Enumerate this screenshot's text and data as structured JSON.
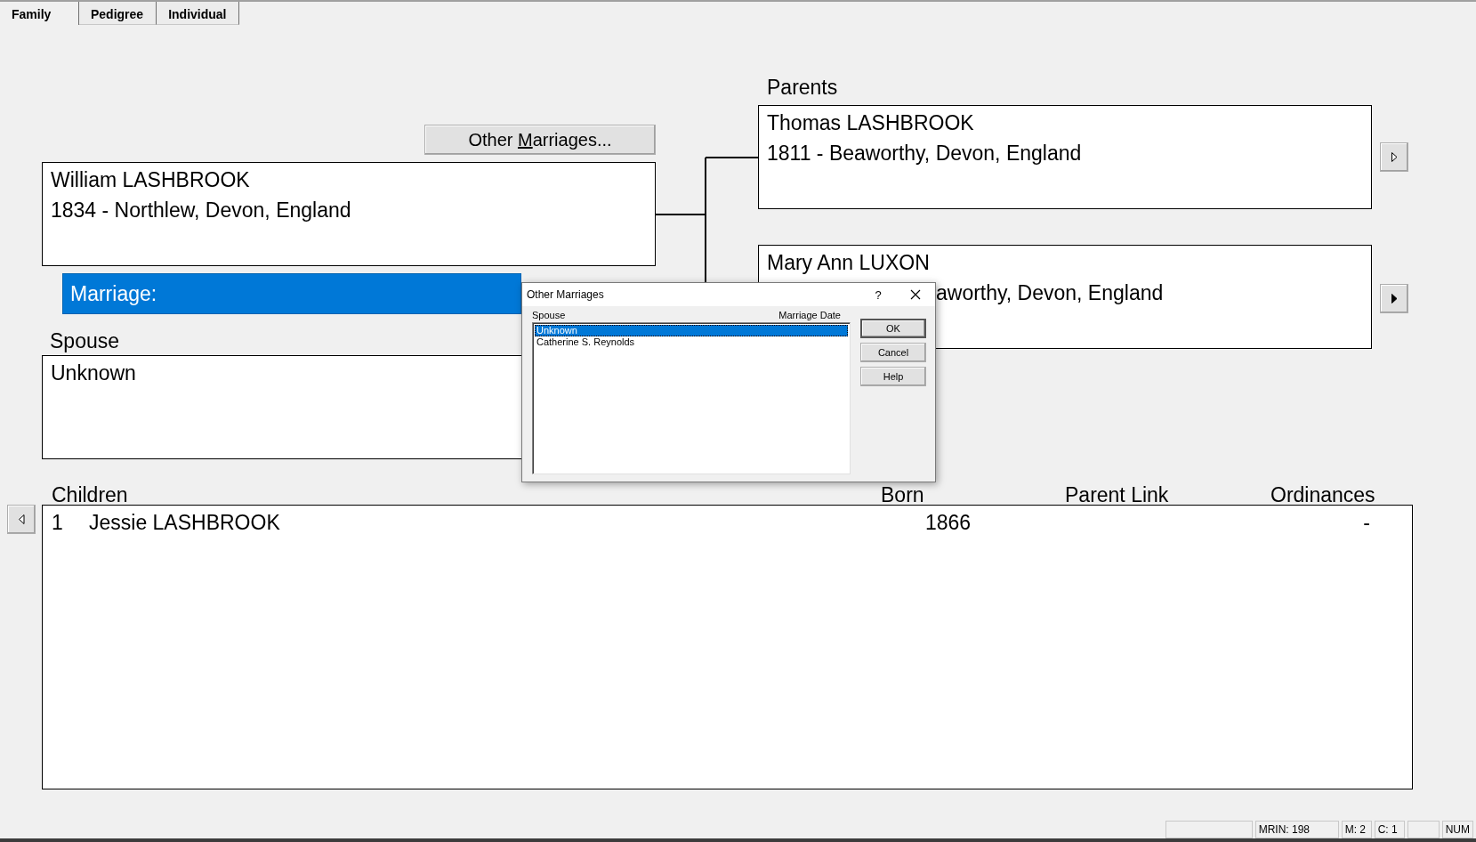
{
  "tabs": [
    {
      "label": "Family",
      "selected": true
    },
    {
      "label": "Pedigree",
      "selected": false
    },
    {
      "label": "Individual",
      "selected": false
    }
  ],
  "other_marriages_button": {
    "before": "Other ",
    "mnemonic": "M",
    "after": "arriages..."
  },
  "individual": {
    "name": "William LASHBROOK",
    "details": "1834 - Northlew, Devon, England"
  },
  "marriage": {
    "label": "Marriage:",
    "selected": true
  },
  "spouse": {
    "label": "Spouse",
    "name": "Unknown"
  },
  "parents": {
    "label": "Parents",
    "father": {
      "name": "Thomas LASHBROOK",
      "details": "1811 - Beaworthy, Devon, England"
    },
    "mother": {
      "name": "Mary Ann LUXON",
      "details": "aworthy, Devon, England"
    }
  },
  "children": {
    "label": "Children",
    "columns": [
      "Born",
      "Parent Link",
      "Ordinances"
    ],
    "rows": [
      {
        "number": "1",
        "name": "Jessie LASHBROOK",
        "born": "1866",
        "ordinances": "-"
      }
    ]
  },
  "dialog": {
    "title": "Other Marriages",
    "help": "?",
    "columns": [
      "Spouse",
      "Marriage Date"
    ],
    "rows": [
      {
        "spouse": "Unknown",
        "selected": true
      },
      {
        "spouse": "Catherine S. Reynolds",
        "selected": false
      }
    ],
    "buttons": [
      {
        "label": "OK",
        "default": true
      },
      {
        "label": "Cancel",
        "default": false
      },
      {
        "label": "Help",
        "default": false
      }
    ]
  },
  "status_bar": {
    "panels": [
      "MRIN: 198",
      "M: 2",
      "C: 1",
      "NUM"
    ]
  }
}
